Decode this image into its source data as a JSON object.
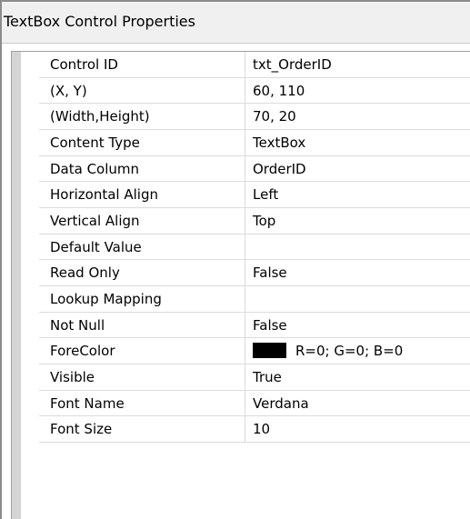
{
  "window": {
    "title": "TextBox Control Properties"
  },
  "properties": [
    {
      "name": "Control ID",
      "value": "txt_OrderID"
    },
    {
      "name": "(X, Y)",
      "value": "60, 110"
    },
    {
      "name": "(Width,Height)",
      "value": "70, 20"
    },
    {
      "name": "Content Type",
      "value": "TextBox"
    },
    {
      "name": "Data Column",
      "value": "OrderID"
    },
    {
      "name": "Horizontal Align",
      "value": "Left"
    },
    {
      "name": "Vertical Align",
      "value": "Top"
    },
    {
      "name": "Default Value",
      "value": ""
    },
    {
      "name": "Read Only",
      "value": "False"
    },
    {
      "name": "Lookup Mapping",
      "value": ""
    },
    {
      "name": "Not Null",
      "value": "False"
    },
    {
      "name": "ForeColor",
      "value": "R=0; G=0; B=0",
      "swatch_color": "#000000"
    },
    {
      "name": "Visible",
      "value": "True"
    },
    {
      "name": "Font Name",
      "value": "Verdana"
    },
    {
      "name": "Font Size",
      "value": "10"
    }
  ]
}
